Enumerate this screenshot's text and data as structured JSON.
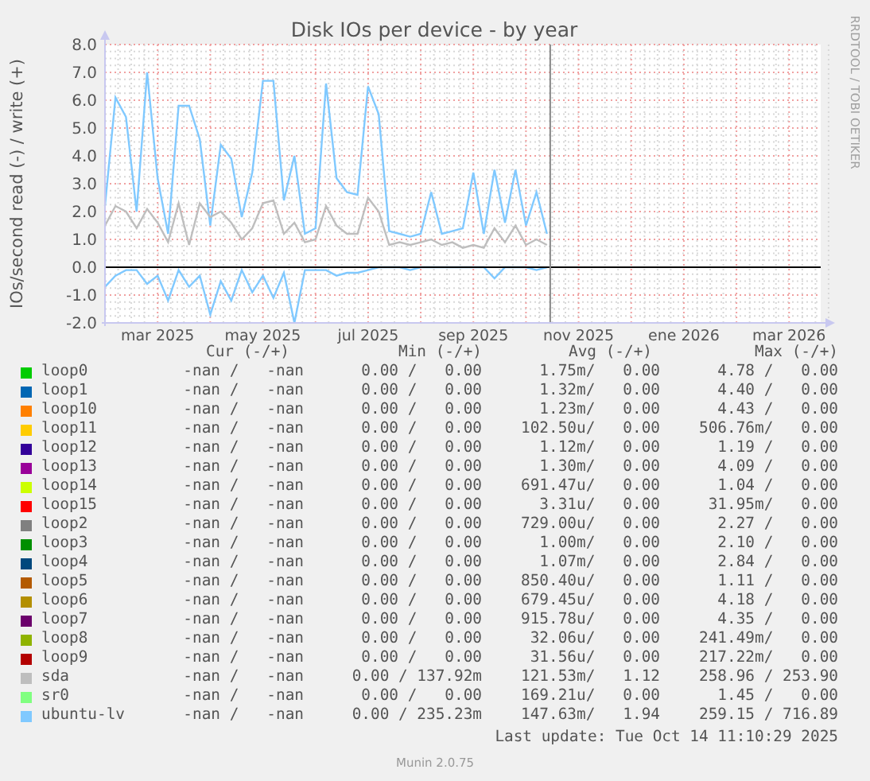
{
  "chart": {
    "chart_data": {
      "type": "line",
      "title": "Disk IOs per device - by year",
      "ylabel": "IOs/second read (-) / write (+)",
      "categories": [
        null,
        null,
        null,
        null,
        null,
        "mar 2025",
        null,
        null,
        null,
        null,
        null,
        null,
        null,
        null,
        null,
        "may 2025",
        null,
        null,
        null,
        null,
        null,
        null,
        null,
        null,
        null,
        "jul 2025",
        null,
        null,
        null,
        null,
        null,
        null,
        null,
        null,
        null,
        "sep 2025",
        null,
        null,
        null,
        null,
        null,
        null,
        null,
        null,
        null,
        "nov 2025",
        null,
        null,
        null,
        null,
        null,
        null,
        null,
        null,
        null,
        "ene 2026",
        null,
        null,
        null,
        null,
        null,
        null,
        null,
        null,
        null,
        "mar 2026",
        null,
        null,
        null
      ],
      "series": [
        {
          "color": "#80c9ff",
          "values": [
            2.2,
            6.1,
            5.4,
            2.0,
            7.0,
            3.2,
            1.2,
            5.8,
            5.8,
            4.6,
            1.5,
            4.4,
            3.9,
            1.8,
            3.4,
            6.7,
            6.7,
            2.4,
            4.0,
            1.2,
            1.4,
            6.6,
            3.2,
            2.7,
            2.6,
            6.5,
            5.5,
            1.3,
            1.2,
            1.1,
            1.2,
            2.7,
            1.2,
            1.3,
            1.4,
            3.4,
            1.2,
            3.5,
            1.6,
            3.5,
            1.5,
            2.7,
            1.2,
            null,
            null,
            null,
            null,
            null,
            null,
            null,
            null,
            null,
            null,
            null,
            null,
            null,
            null,
            null,
            null,
            null,
            null,
            null,
            null,
            null,
            null,
            null,
            null,
            null,
            null
          ]
        },
        {
          "color": "#bebebe",
          "values": [
            1.5,
            2.2,
            2.0,
            1.4,
            2.1,
            1.6,
            0.9,
            2.3,
            0.8,
            2.3,
            1.8,
            2.0,
            1.6,
            1.0,
            1.4,
            2.3,
            2.4,
            1.2,
            1.6,
            0.9,
            1.0,
            2.2,
            1.5,
            1.2,
            1.2,
            2.5,
            2.0,
            0.8,
            0.9,
            0.8,
            0.9,
            1.0,
            0.8,
            0.9,
            0.7,
            0.8,
            0.7,
            1.4,
            0.9,
            1.5,
            0.8,
            1.0,
            0.8,
            null,
            null,
            null,
            null,
            null,
            null,
            null,
            null,
            null,
            null,
            null,
            null,
            null,
            null,
            null,
            null,
            null,
            null,
            null,
            null,
            null,
            null,
            null,
            null,
            null,
            null
          ]
        },
        {
          "color": "#80c9ff",
          "values": [
            -0.7,
            -0.3,
            -0.1,
            -0.1,
            -0.6,
            -0.3,
            -1.2,
            -0.1,
            -0.7,
            -0.3,
            -1.7,
            -0.5,
            -1.2,
            -0.1,
            -0.9,
            -0.3,
            -1.1,
            -0.2,
            -2.0,
            -0.1,
            -0.1,
            -0.1,
            -0.3,
            -0.2,
            -0.2,
            -0.1,
            0,
            0,
            0,
            -0.1,
            0,
            0,
            0,
            0,
            0,
            0,
            0,
            -0.4,
            0,
            0,
            0,
            -0.1,
            0,
            null,
            null,
            null,
            null,
            null,
            null,
            null,
            null,
            null,
            null,
            null,
            null,
            null,
            null,
            null,
            null,
            null,
            null,
            null,
            null,
            null,
            null,
            null,
            null,
            null,
            null
          ]
        }
      ],
      "ylim": [
        -2,
        8
      ],
      "grid": true,
      "yticks": [
        {
          "value": 8,
          "label": "8.0"
        },
        {
          "value": 7,
          "label": "7.0"
        },
        {
          "value": 6,
          "label": "6.0"
        },
        {
          "value": 5,
          "label": "5.0"
        },
        {
          "value": 4,
          "label": "4.0"
        },
        {
          "value": 3,
          "label": "3.0"
        },
        {
          "value": 2,
          "label": "2.0"
        },
        {
          "value": 1,
          "label": "1.0"
        },
        {
          "value": 0,
          "label": "0.0"
        },
        {
          "value": -1,
          "label": "-1.0"
        },
        {
          "value": -2,
          "label": "-2.0"
        }
      ]
    }
  },
  "watermark": "RRDTOOL / TOBI OETIKER",
  "legend": {
    "columns": [
      "Cur (-/+)",
      "Min (-/+)",
      "Avg (-/+)",
      "Max (-/+)"
    ],
    "rows": [
      {
        "name": "loop0",
        "color": "#00cc00",
        "cur": "-nan /   -nan",
        "min": "0.00 /   0.00",
        "avg": "1.75m/   0.00",
        "max": "4.78 /   0.00"
      },
      {
        "name": "loop1",
        "color": "#0066b3",
        "cur": "-nan /   -nan",
        "min": "0.00 /   0.00",
        "avg": "1.32m/   0.00",
        "max": "4.40 /   0.00"
      },
      {
        "name": "loop10",
        "color": "#ff8000",
        "cur": "-nan /   -nan",
        "min": "0.00 /   0.00",
        "avg": "1.23m/   0.00",
        "max": "4.43 /   0.00"
      },
      {
        "name": "loop11",
        "color": "#ffcc00",
        "cur": "-nan /   -nan",
        "min": "0.00 /   0.00",
        "avg": "102.50u/   0.00",
        "max": "506.76m/   0.00"
      },
      {
        "name": "loop12",
        "color": "#330099",
        "cur": "-nan /   -nan",
        "min": "0.00 /   0.00",
        "avg": "1.12m/   0.00",
        "max": "1.19 /   0.00"
      },
      {
        "name": "loop13",
        "color": "#990099",
        "cur": "-nan /   -nan",
        "min": "0.00 /   0.00",
        "avg": "1.30m/   0.00",
        "max": "4.09 /   0.00"
      },
      {
        "name": "loop14",
        "color": "#ccff00",
        "cur": "-nan /   -nan",
        "min": "0.00 /   0.00",
        "avg": "691.47u/   0.00",
        "max": "1.04 /   0.00"
      },
      {
        "name": "loop15",
        "color": "#ff0000",
        "cur": "-nan /   -nan",
        "min": "0.00 /   0.00",
        "avg": "3.31u/   0.00",
        "max": "31.95m/   0.00"
      },
      {
        "name": "loop2",
        "color": "#808080",
        "cur": "-nan /   -nan",
        "min": "0.00 /   0.00",
        "avg": "729.00u/   0.00",
        "max": "2.27 /   0.00"
      },
      {
        "name": "loop3",
        "color": "#008f00",
        "cur": "-nan /   -nan",
        "min": "0.00 /   0.00",
        "avg": "1.00m/   0.00",
        "max": "2.10 /   0.00"
      },
      {
        "name": "loop4",
        "color": "#00487d",
        "cur": "-nan /   -nan",
        "min": "0.00 /   0.00",
        "avg": "1.07m/   0.00",
        "max": "2.84 /   0.00"
      },
      {
        "name": "loop5",
        "color": "#b35a00",
        "cur": "-nan /   -nan",
        "min": "0.00 /   0.00",
        "avg": "850.40u/   0.00",
        "max": "1.11 /   0.00"
      },
      {
        "name": "loop6",
        "color": "#b38f00",
        "cur": "-nan /   -nan",
        "min": "0.00 /   0.00",
        "avg": "679.45u/   0.00",
        "max": "4.18 /   0.00"
      },
      {
        "name": "loop7",
        "color": "#6b006b",
        "cur": "-nan /   -nan",
        "min": "0.00 /   0.00",
        "avg": "915.78u/   0.00",
        "max": "4.35 /   0.00"
      },
      {
        "name": "loop8",
        "color": "#8fb300",
        "cur": "-nan /   -nan",
        "min": "0.00 /   0.00",
        "avg": "32.06u/   0.00",
        "max": "241.49m/   0.00"
      },
      {
        "name": "loop9",
        "color": "#b30000",
        "cur": "-nan /   -nan",
        "min": "0.00 /   0.00",
        "avg": "31.56u/   0.00",
        "max": "217.22m/   0.00"
      },
      {
        "name": "sda",
        "color": "#bebebe",
        "cur": "-nan /   -nan",
        "min": "0.00 / 137.92m",
        "avg": "121.53m/   1.12",
        "max": "258.96 / 253.90"
      },
      {
        "name": "sr0",
        "color": "#80ff80",
        "cur": "-nan /   -nan",
        "min": "0.00 /   0.00",
        "avg": "169.21u/   0.00",
        "max": "1.45 /   0.00"
      },
      {
        "name": "ubuntu-lv",
        "color": "#80c9ff",
        "cur": "-nan /   -nan",
        "min": "0.00 / 235.23m",
        "avg": "147.63m/   1.94",
        "max": "259.15 / 716.89"
      }
    ]
  },
  "last_update": "Last update: Tue Oct 14 11:10:29 2025",
  "footer": "Munin 2.0.75"
}
